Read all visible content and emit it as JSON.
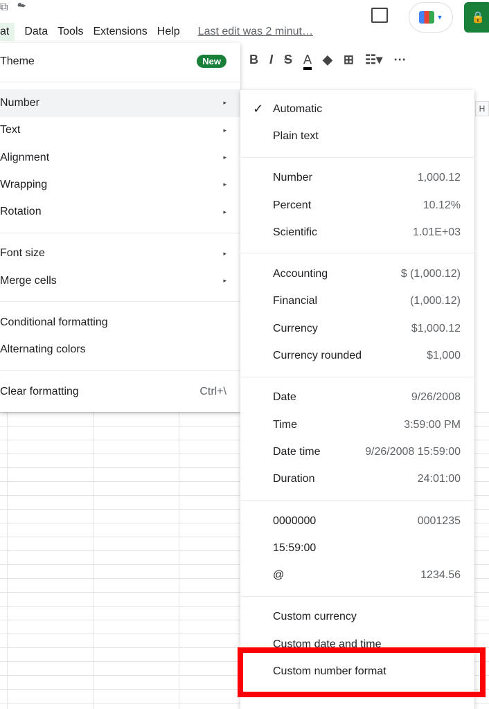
{
  "menubar": {
    "items": [
      "at",
      "Data",
      "Tools",
      "Extensions",
      "Help"
    ],
    "last_edit": "Last edit was 2 minut…"
  },
  "toolbar": {
    "bold": "B",
    "italic": "I",
    "strike": "S",
    "text_color": "A",
    "more": "⋯"
  },
  "column_header": "H",
  "format_menu": {
    "items": [
      {
        "label": "Theme",
        "badge": "New"
      },
      {
        "label": "Number",
        "arrow": "▸"
      },
      {
        "label": "Text",
        "arrow": "▸"
      },
      {
        "label": "Alignment",
        "arrow": "▸"
      },
      {
        "label": "Wrapping",
        "arrow": "▸"
      },
      {
        "label": "Rotation",
        "arrow": "▸"
      },
      {
        "label": "Font size",
        "arrow": "▸"
      },
      {
        "label": "Merge cells",
        "arrow": "▸"
      },
      {
        "label": "Conditional formatting"
      },
      {
        "label": "Alternating colors"
      },
      {
        "label": "Clear formatting",
        "shortcut": "Ctrl+\\"
      }
    ]
  },
  "number_submenu": {
    "items": [
      {
        "label": "Automatic",
        "checked": true
      },
      {
        "label": "Plain text"
      },
      {
        "label": "Number",
        "example": "1,000.12"
      },
      {
        "label": "Percent",
        "example": "10.12%"
      },
      {
        "label": "Scientific",
        "example": "1.01E+03"
      },
      {
        "label": "Accounting",
        "example": "$ (1,000.12)"
      },
      {
        "label": "Financial",
        "example": "(1,000.12)"
      },
      {
        "label": "Currency",
        "example": "$1,000.12"
      },
      {
        "label": "Currency rounded",
        "example": "$1,000"
      },
      {
        "label": "Date",
        "example": "9/26/2008"
      },
      {
        "label": "Time",
        "example": "3:59:00 PM"
      },
      {
        "label": "Date time",
        "example": "9/26/2008 15:59:00"
      },
      {
        "label": "Duration",
        "example": "24:01:00"
      },
      {
        "label": "0000000",
        "example": "0001235"
      },
      {
        "label": "15:59:00"
      },
      {
        "label": "@",
        "example": "1234.56"
      },
      {
        "label": "Custom currency"
      },
      {
        "label": "Custom date and time"
      },
      {
        "label": "Custom number format",
        "highlighted_annotation": true
      }
    ]
  },
  "colors": {
    "accent_green": "#188038",
    "highlight_red": "#ff0000"
  }
}
